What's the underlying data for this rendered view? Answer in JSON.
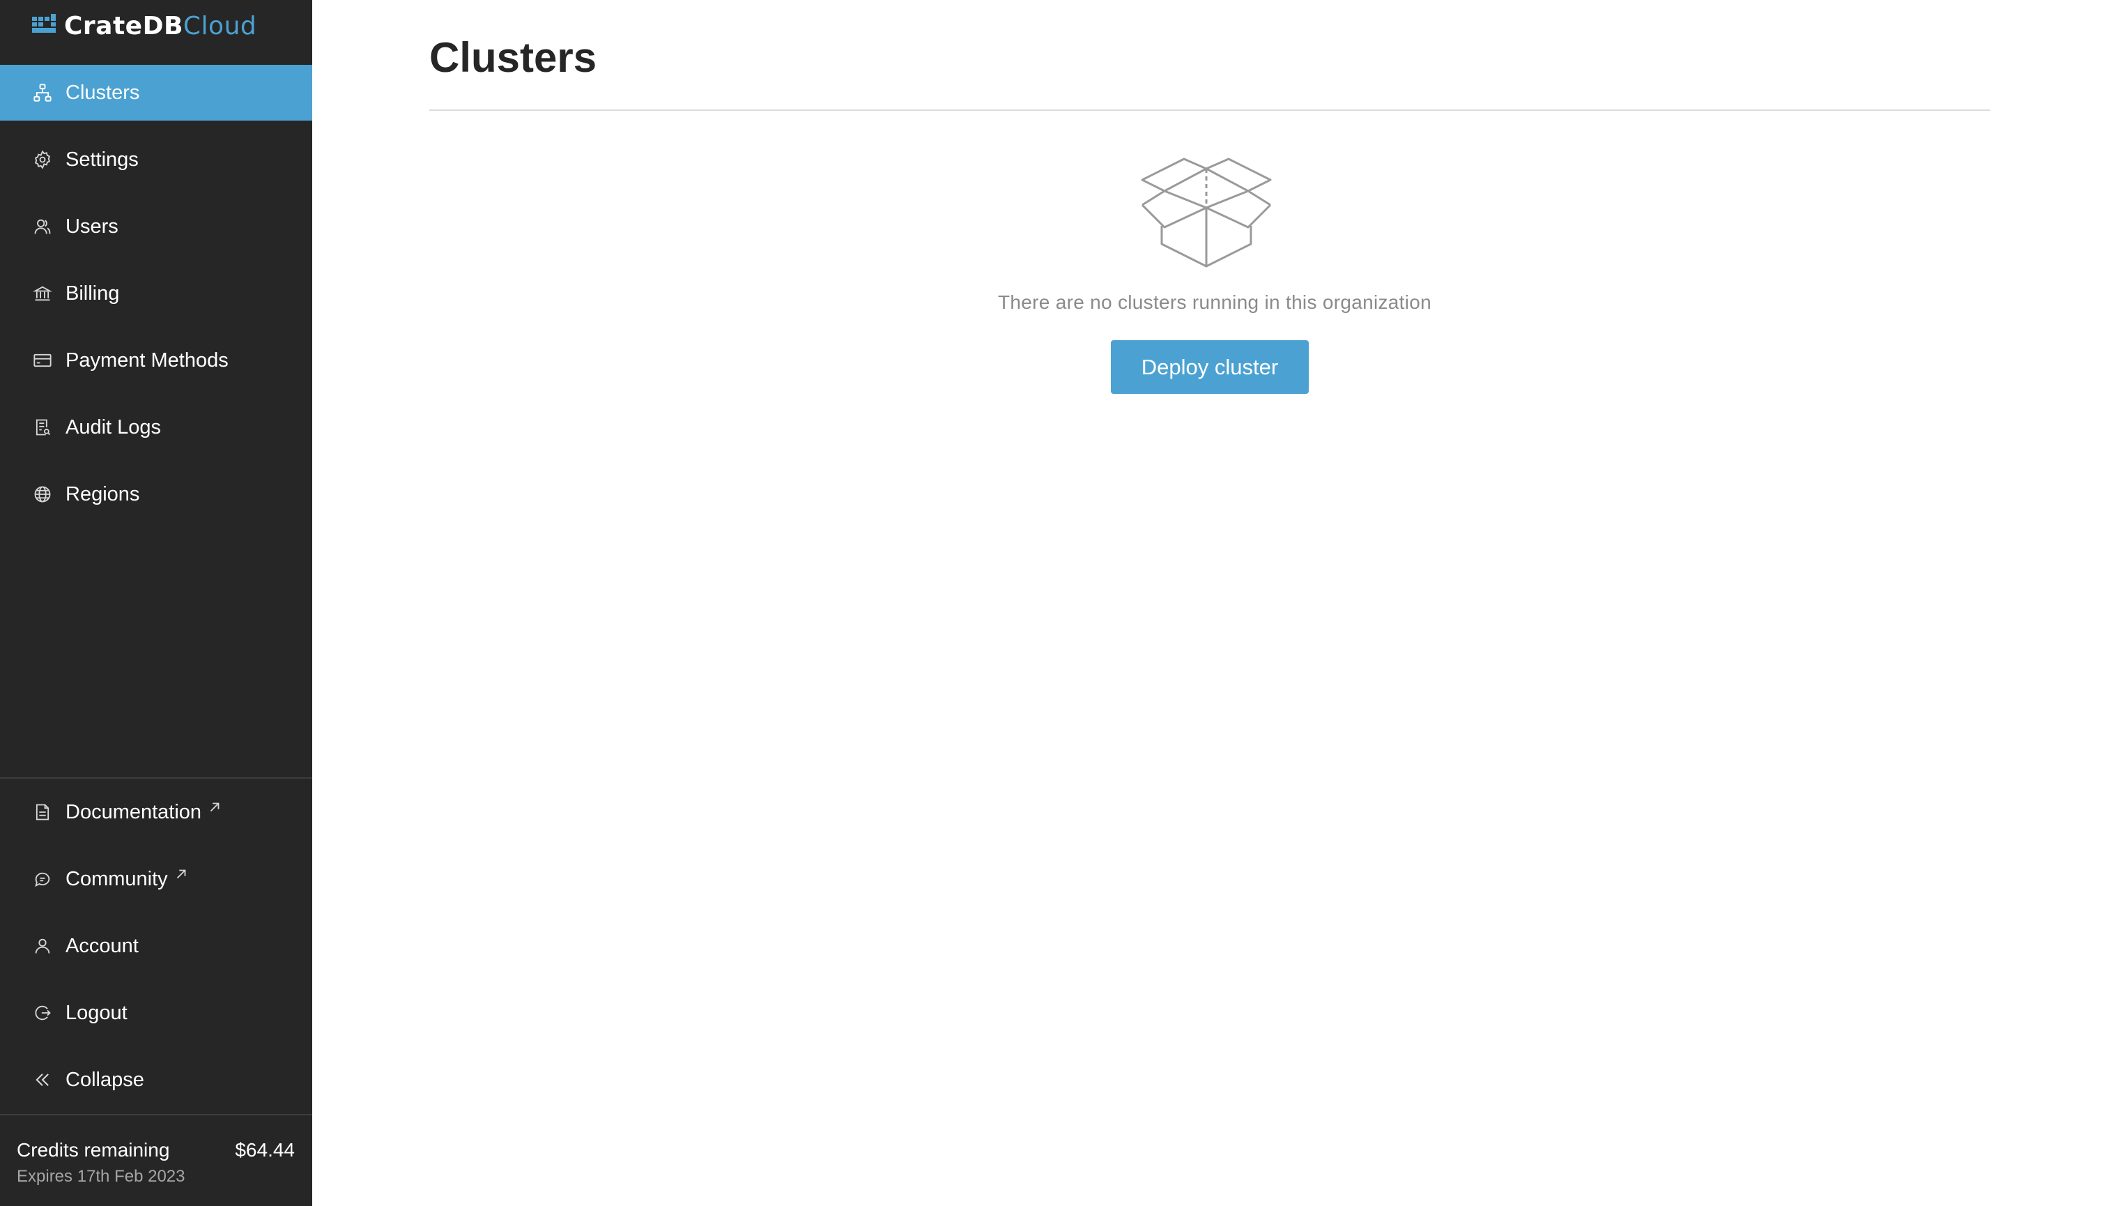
{
  "app": {
    "logo_text_main": "CrateDB",
    "logo_text_accent": "Cloud",
    "accent_color": "#4ba2d2",
    "sidebar_bg": "#262626"
  },
  "sidebar": {
    "items": [
      {
        "label": "Clusters",
        "icon": "clusters-icon",
        "active": true
      },
      {
        "label": "Settings",
        "icon": "gear-icon"
      },
      {
        "label": "Users",
        "icon": "users-icon"
      },
      {
        "label": "Billing",
        "icon": "bank-icon"
      },
      {
        "label": "Payment Methods",
        "icon": "credit-card-icon"
      },
      {
        "label": "Audit Logs",
        "icon": "audit-log-icon"
      },
      {
        "label": "Regions",
        "icon": "globe-icon"
      }
    ],
    "bottom_items": [
      {
        "label": "Documentation",
        "icon": "document-icon",
        "external": true
      },
      {
        "label": "Community",
        "icon": "chat-icon",
        "external": true
      },
      {
        "label": "Account",
        "icon": "user-icon"
      },
      {
        "label": "Logout",
        "icon": "logout-icon"
      },
      {
        "label": "Collapse",
        "icon": "chevrons-left-icon"
      }
    ],
    "credits": {
      "label": "Credits remaining",
      "amount": "$64.44",
      "expiry": "Expires 17th Feb 2023"
    }
  },
  "main": {
    "title": "Clusters",
    "empty_state": {
      "icon": "empty-box-icon",
      "message": "There are no clusters running in this organization",
      "button_label": "Deploy cluster"
    }
  }
}
